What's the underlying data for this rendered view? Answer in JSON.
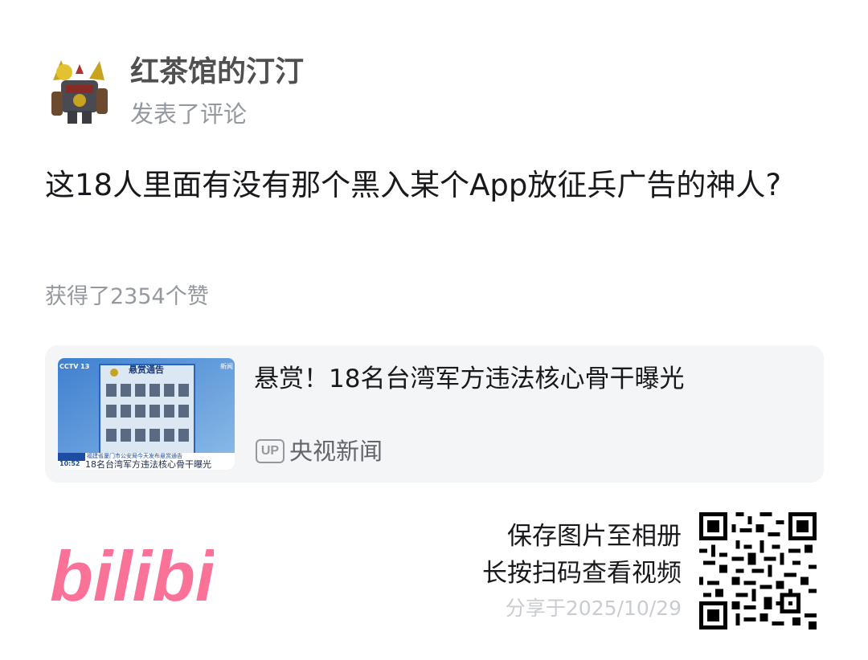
{
  "post": {
    "user_name": "红茶馆的汀汀",
    "action": "发表了评论",
    "comment": "这18人里面有没有那个黑入某个App放征兵广告的神人?",
    "likes": "获得了2354个赞"
  },
  "video_card": {
    "title": "悬赏！18名台湾军方违法核心骨干曝光",
    "up_badge": "UP",
    "channel": "央视新闻",
    "thumbnail": {
      "notice_title": "悬赏通告",
      "corner_top_left": "CCTV 13",
      "corner_top_right": "新闻",
      "ticker_small": "福建省厦门市公安局今天发布悬赏通告",
      "ticker_time": "10:52",
      "caption": "18名台湾军方违法核心骨干曝光"
    }
  },
  "footer": {
    "logo_text": "bilibili",
    "save": "保存图片至相册",
    "scan": "长按扫码查看视频",
    "share_date": "分享于2025/10/29"
  },
  "colors": {
    "brand_pink": "#fb7299",
    "muted_text": "#9499a0",
    "card_bg": "#f4f5f7"
  }
}
